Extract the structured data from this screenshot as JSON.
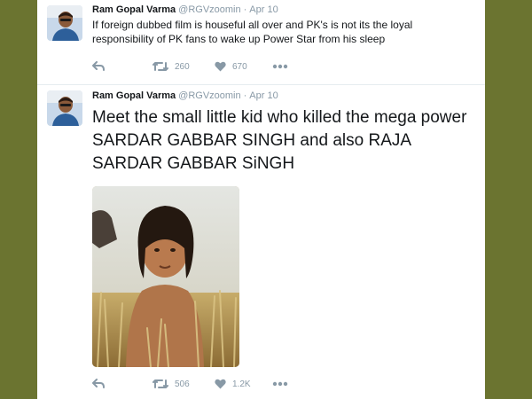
{
  "colors": {
    "page_background": "#6b7430",
    "card_background": "#ffffff",
    "text": "#14171a",
    "muted": "#8899a6"
  },
  "tweets": [
    {
      "author_name": "Ram Gopal Varma",
      "handle": "@RGVzoomin",
      "separator": "·",
      "date": "Apr 10",
      "text": "If foreign dubbed film is houseful all over and PK's is not its the loyal responsibility of PK fans to wake up  Power Star from his sleep",
      "retweets": "260",
      "likes": "670",
      "icons": [
        "reply-icon",
        "retweet-icon",
        "like-icon",
        "more-icon"
      ]
    },
    {
      "author_name": "Ram Gopal Varma",
      "handle": "@RGVzoomin",
      "separator": "·",
      "date": "Apr 10",
      "text": "Meet the small little kid who killed the mega power SARDAR GABBAR SINGH and also RAJA SARDAR GABBAR SiNGH",
      "retweets": "506",
      "likes": "1.2K",
      "icons": [
        "reply-icon",
        "retweet-icon",
        "like-icon",
        "more-icon"
      ]
    }
  ]
}
